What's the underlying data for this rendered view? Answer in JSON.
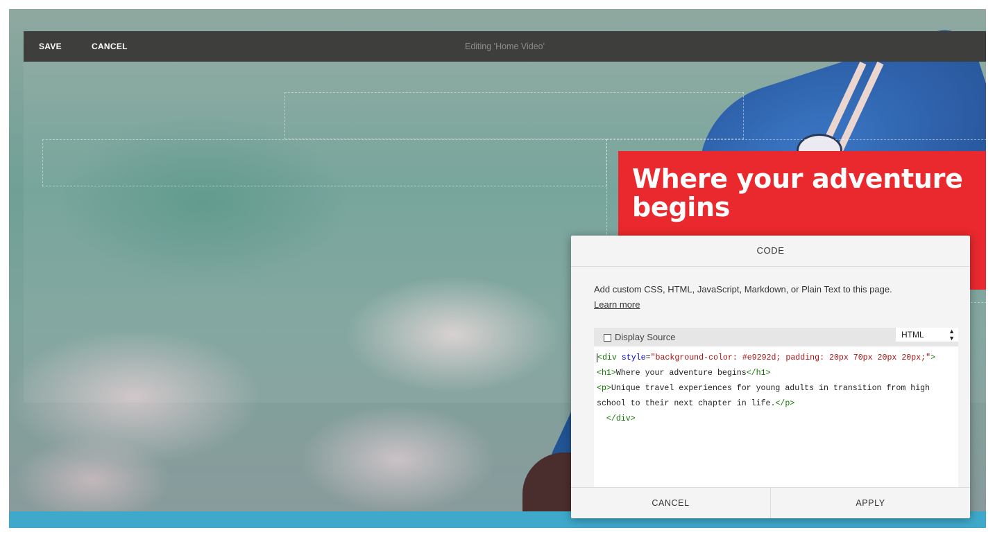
{
  "toolbar": {
    "save_label": "SAVE",
    "cancel_label": "CANCEL",
    "title": "Editing 'Home Video'"
  },
  "hero": {
    "title": "Where your adventure begins",
    "background_color": "#e9292d"
  },
  "code_dialog": {
    "title": "CODE",
    "description": "Add custom CSS, HTML, JavaScript, Markdown, or Plain Text to this page.",
    "learn_more": "Learn more",
    "display_source_label": "Display Source",
    "display_source_checked": false,
    "language": "HTML",
    "code_lines": {
      "l1_open": "<div",
      "l1_attr": " style",
      "l1_eq": "=",
      "l1_value": "\"background-color: #e9292d; padding: 20px 70px 20px 20px;\"",
      "l1_close": ">",
      "l2_open": "<h1>",
      "l2_text": "Where your adventure begins",
      "l2_close": "</h1>",
      "l3_open": "<p>",
      "l3_text": "Unique travel experiences for young adults in transition from high",
      "l4_text": "school to their next chapter in life.",
      "l4_close": "</p>",
      "l5_text": "  </div>"
    },
    "cancel_label": "CANCEL",
    "apply_label": "APPLY"
  },
  "colors": {
    "toolbar_bg": "#3e3e3c",
    "accent_red": "#e9292d",
    "bottom_band": "#3fa9cb"
  },
  "icons": {
    "select_arrows": "up-down-arrows-icon",
    "checkbox": "checkbox-icon"
  }
}
